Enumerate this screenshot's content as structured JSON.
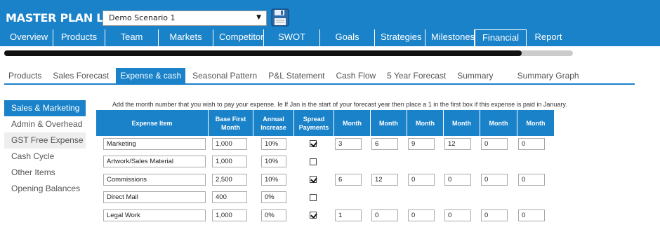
{
  "app": {
    "title": "MASTER PLAN LEAN",
    "scenario_selected": "Demo Scenario 1",
    "save_icon": "floppy-disk-icon"
  },
  "main_nav": [
    {
      "label": "Overview"
    },
    {
      "label": "Products"
    },
    {
      "label": "Team"
    },
    {
      "label": "Markets"
    },
    {
      "label": "Competitor"
    },
    {
      "label": "SWOT"
    },
    {
      "label": "Goals"
    },
    {
      "label": "Strategies"
    },
    {
      "label": "Milestones"
    },
    {
      "label": "Financial",
      "active": true
    },
    {
      "label": "Report"
    }
  ],
  "progress": {
    "fraction": 0.91
  },
  "sub_tabs": [
    {
      "label": "Products"
    },
    {
      "label": "Sales Forecast"
    },
    {
      "label": "Expense & cash",
      "active": true
    },
    {
      "label": "Seasonal Pattern"
    },
    {
      "label": "P&L Statement"
    },
    {
      "label": "Cash Flow"
    },
    {
      "label": "5 Year Forecast"
    },
    {
      "label": "Summary"
    },
    {
      "label": "Summary Graph"
    }
  ],
  "side_menu": [
    {
      "label": "Sales & Marketing",
      "active": true
    },
    {
      "label": "Admin & Overhead"
    },
    {
      "label": "GST Free Expense",
      "shaded": true
    },
    {
      "label": "Cash Cycle"
    },
    {
      "label": "Other Items"
    },
    {
      "label": "Opening Balances"
    }
  ],
  "instructions": "Add the month number that you wish to pay your expense. Ie If Jan is the start of your forecast year then place a 1 in the first box if this expense is paid in January.",
  "table": {
    "headers": {
      "item": "Expense Item",
      "base": "Base First Month",
      "annual": "Annual Increase",
      "spread": "Spread Payments",
      "months": [
        "Month",
        "Month",
        "Month",
        "Month",
        "Month",
        "Month"
      ]
    },
    "rows": [
      {
        "item": "Marketing",
        "base": "1,000",
        "annual": "10%",
        "spread": true,
        "months": [
          "3",
          "6",
          "9",
          "12",
          "0",
          "0"
        ]
      },
      {
        "item": "Artwork/Sales Material",
        "base": "1,000",
        "annual": "10%",
        "spread": false,
        "months": []
      },
      {
        "item": "Commissions",
        "base": "2,500",
        "annual": "10%",
        "spread": true,
        "months": [
          "6",
          "12",
          "0",
          "0",
          "0",
          "0"
        ]
      },
      {
        "item": "Direct Mail",
        "base": "400",
        "annual": "0%",
        "spread": false,
        "months": []
      },
      {
        "item": "Legal Work",
        "base": "1,000",
        "annual": "0%",
        "spread": true,
        "months": [
          "1",
          "0",
          "0",
          "0",
          "0",
          "0"
        ]
      }
    ]
  }
}
